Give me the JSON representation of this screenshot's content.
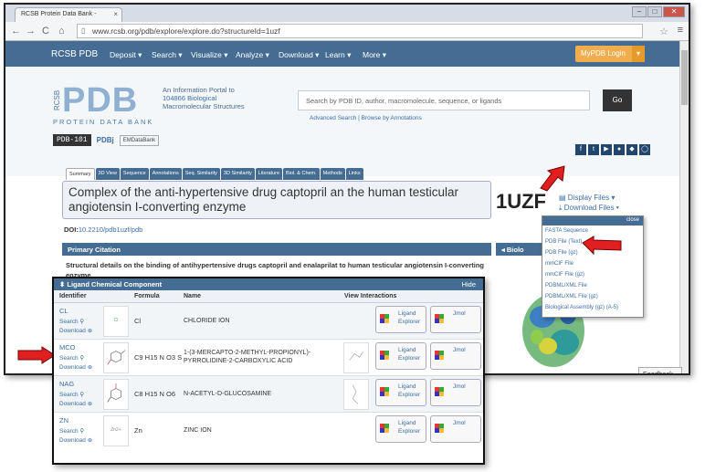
{
  "browser": {
    "tab_title": "RCSB Protein Data Bank -",
    "url": "www.rcsb.org/pdb/explore/explore.do?structureId=1uzf",
    "window_controls": [
      "–",
      "□",
      "✕"
    ]
  },
  "navbar": {
    "brand": "RCSB PDB",
    "items": [
      "Deposit ▾",
      "Search ▾",
      "Visualize ▾",
      "Analyze ▾",
      "Download ▾",
      "Learn ▾",
      "More ▾"
    ],
    "login": "MyPDB Login"
  },
  "header": {
    "logo_big": "PDB",
    "logo_side": "RCSB",
    "logo_text": "PROTEIN DATA BANK",
    "portal_lines": [
      "An Information Portal to",
      "104866 Biological",
      "Macromolecular Structures"
    ],
    "search_placeholder": "Search by PDB ID, author, macromolecule, sequence, or ligands",
    "go": "Go",
    "advanced": "Advanced Search | Browse by Annotations",
    "partner_101": "PDB-101",
    "partner_pdbj": "PDBj",
    "partner_emdb": "EMDataBank"
  },
  "page_tabs": [
    "Summary",
    "3D View",
    "Sequence",
    "Annotations",
    "Seq. Similarity",
    "3D Similarity",
    "Literature",
    "Biol. & Chem.",
    "Methods",
    "Links"
  ],
  "structure": {
    "title": "Complex of the anti-hypertensive drug captopril an the human testicular angiotensin I-converting enzyme",
    "id": "1UZF",
    "display_files": "Display Files ▾",
    "download_files": "Download Files ▾",
    "doi_label": "DOI:",
    "doi": "10.2210/pdb1uzf/pdb"
  },
  "citation": {
    "header": "Primary Citation",
    "text": "Structural details on the binding of antihypertensive drugs captopril and enalaprilat to human testicular angiotensin I-converting enzyme."
  },
  "bio_header": "Biolo",
  "download_menu": {
    "close": "close",
    "items": [
      "FASTA Sequence",
      "PDB File (Text)",
      "PDB File (gz)",
      "mmCIF File",
      "mmCIF File (gz)",
      "PDBML/XML File",
      "PDBML/XML File (gz)",
      "Biological Assembly (gz) (A-5)"
    ]
  },
  "feedback": "Feedback",
  "ligands": {
    "header": "Ligand Chemical Component",
    "hide": "Hide",
    "columns": [
      "Identifier",
      "Formula",
      "Name",
      "View Interactions"
    ],
    "search_label": "Search",
    "download_label": "Download",
    "explorer_label": [
      "Ligand",
      "Explorer"
    ],
    "jmol_label": "Jmol",
    "rows": [
      {
        "id": "CL",
        "img": "Cl",
        "formula": "Cl",
        "name": "CHLORIDE ION"
      },
      {
        "id": "MCO",
        "img": "",
        "formula": "C9 H15 N O3 S",
        "name": "1-(3-MERCAPTO-2-METHYL-PROPIONYL)-PYRROLIDINE-2-CARBOXYLIC ACID"
      },
      {
        "id": "NAG",
        "img": "",
        "formula": "C8 H15 N O6",
        "name": "N-ACETYL-D-GLUCOSAMINE"
      },
      {
        "id": "ZN",
        "img": "Zn2+",
        "formula": "Zn",
        "name": "ZINC ION"
      }
    ]
  },
  "colors": {
    "nav": "#456d93",
    "login": "#f0ad4e",
    "arrow": "#e02020",
    "link": "#3b6ea5"
  }
}
